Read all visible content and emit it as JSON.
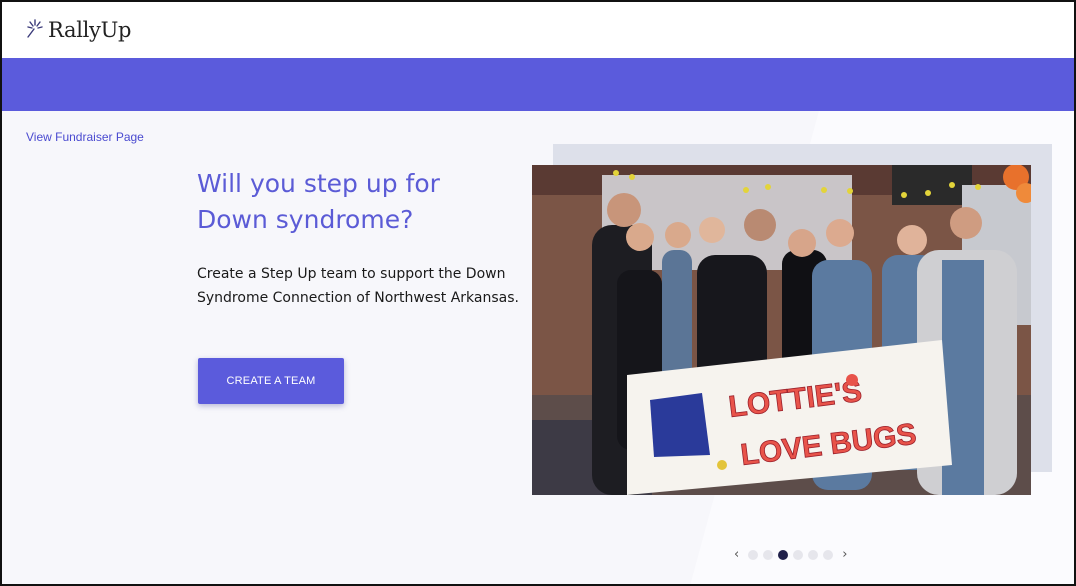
{
  "brand": {
    "name": "RallyUp"
  },
  "colors": {
    "accent": "#5b5bdc",
    "heading": "#5b5bd6",
    "dot_active": "#20204a"
  },
  "link": {
    "view_fundraiser": "View Fundraiser Page"
  },
  "hero": {
    "heading": "Will you step up for Down syndrome?",
    "description": "Create a Step Up team to support the Down Syndrome Connection of Northwest Arkansas.",
    "cta_label": "CREATE A TEAM"
  },
  "photo": {
    "banner_line1": "LOTTIE'S",
    "banner_line2": "LOVE BUGS"
  },
  "carousel": {
    "slide_count": 6,
    "active_index": 2,
    "prev_icon": "chevron-left-icon",
    "next_icon": "chevron-right-icon"
  }
}
